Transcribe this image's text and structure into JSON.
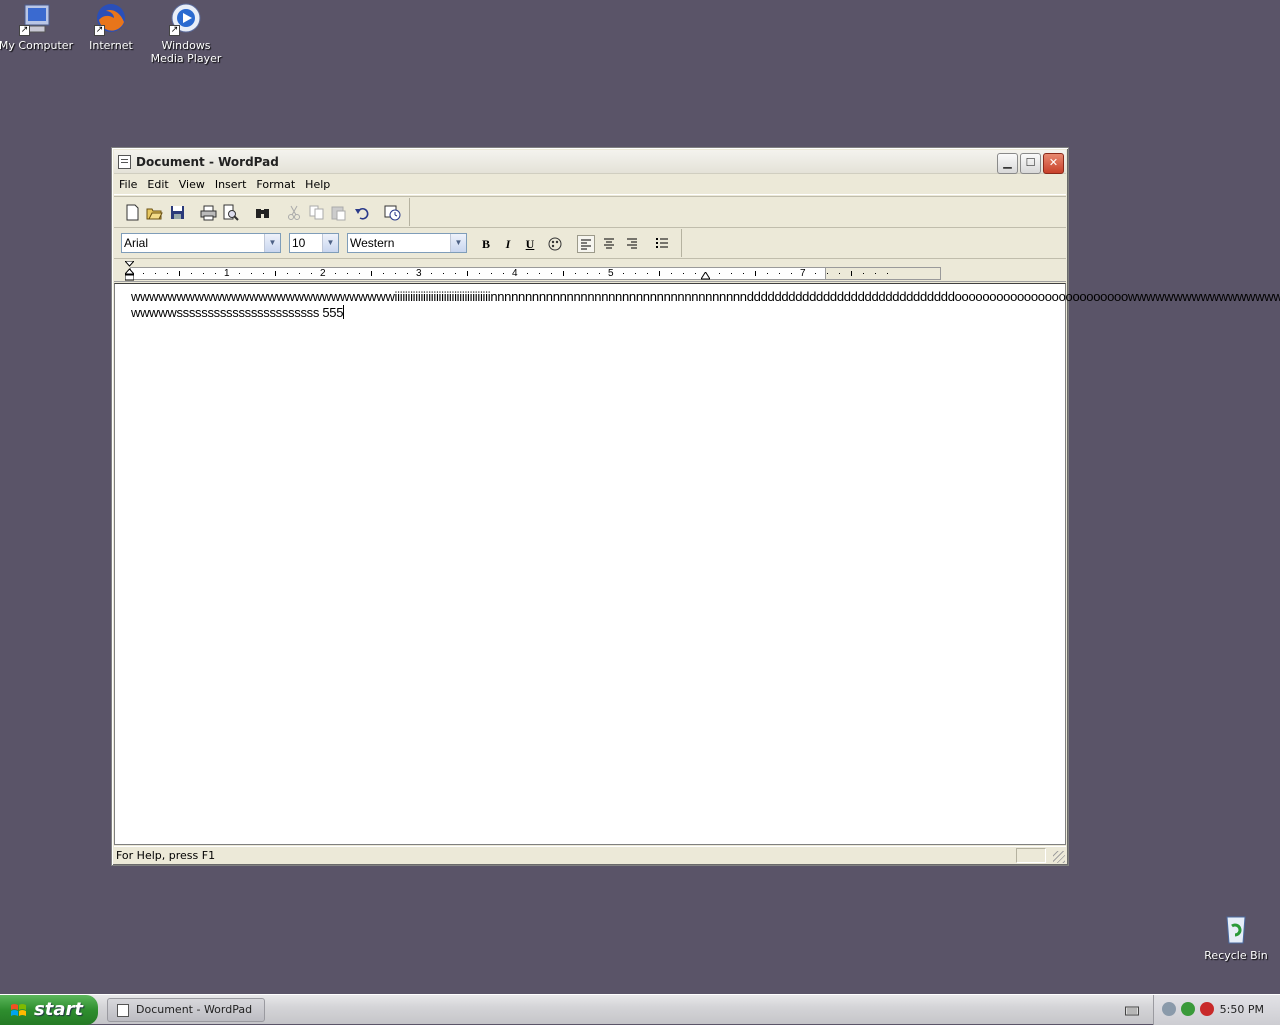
{
  "desktop": {
    "icons": [
      {
        "label": "My Computer"
      },
      {
        "label": "Internet"
      },
      {
        "label": "Windows Media Player"
      },
      {
        "label": "Recycle Bin"
      }
    ]
  },
  "window": {
    "title": "Document - WordPad",
    "menu": [
      "File",
      "Edit",
      "View",
      "Insert",
      "Format",
      "Help"
    ],
    "toolbar_icons": [
      "new-icon",
      "open-icon",
      "save-icon",
      "print-icon",
      "print-preview-icon",
      "find-icon",
      "cut-icon",
      "copy-icon",
      "paste-icon",
      "undo-icon",
      "insert-datetime-icon"
    ],
    "format_bar": {
      "font": "Arial",
      "size": "10",
      "script": "Western",
      "bold": "B",
      "italic": "I",
      "underline": "U",
      "align": "left"
    },
    "ruler": {
      "numbers": [
        "1",
        "2",
        "3",
        "4",
        "5",
        "7"
      ]
    },
    "document": {
      "line1": "wwwwwwwwwwwwwwwwwwwwwwwwwwwwwiiiiiiiiiiiiiiiiiiiiiiiiiiiiiiiiiiiiinnnnnnnnnnnnnnnnnnnnnnnnnnnnnnnnnnnnnddddddddddddddddddddddddddddddooooooooooooooooooooooooowwwwwwwwwwwwwwwwwwwww",
      "line2": "wwwwwsssssssssssssssssssssss 555"
    },
    "status": "For Help, press F1"
  },
  "taskbar": {
    "start": "start",
    "task": "Document - WordPad",
    "clock": "5:50 PM"
  },
  "colors": {
    "desktop": "#5a5468",
    "start_green": "#2e8e2e",
    "close_red": "#c8402a"
  }
}
